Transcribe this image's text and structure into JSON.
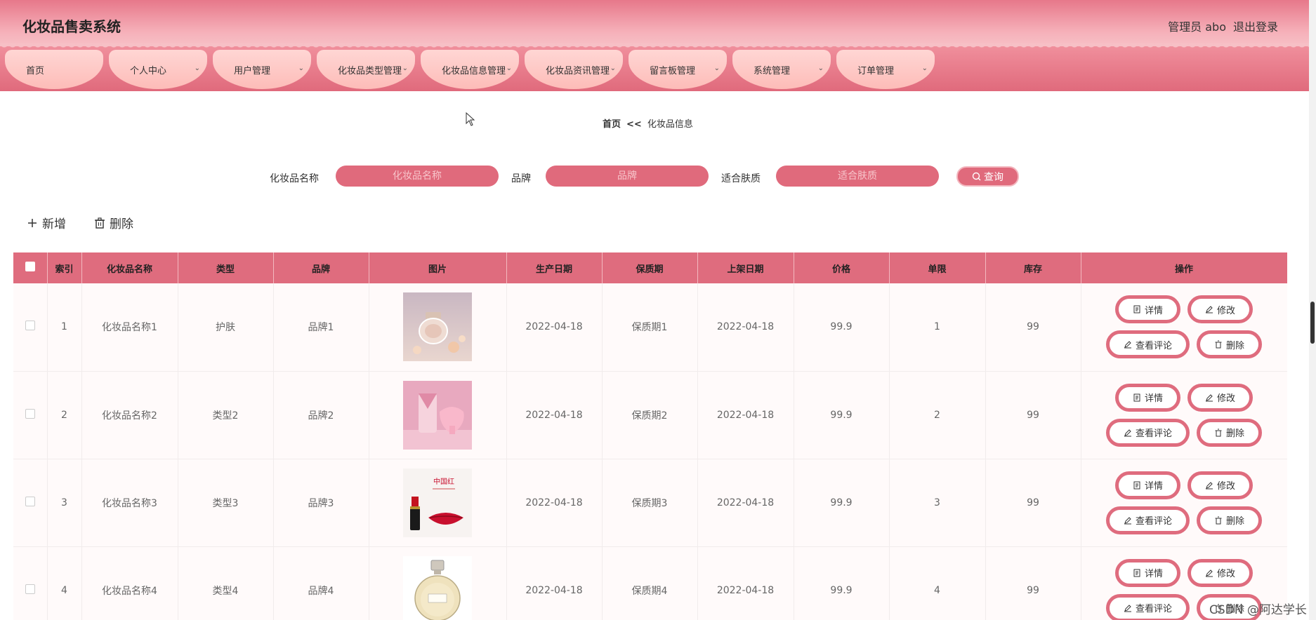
{
  "header": {
    "title": "化妆品售卖系统",
    "admin": "管理员 abo",
    "logout": "退出登录"
  },
  "nav": [
    {
      "label": "首页",
      "has_menu": false
    },
    {
      "label": "个人中心",
      "has_menu": true
    },
    {
      "label": "用户管理",
      "has_menu": true
    },
    {
      "label": "化妆品类型管理",
      "has_menu": true
    },
    {
      "label": "化妆品信息管理",
      "has_menu": true
    },
    {
      "label": "化妆品资讯管理",
      "has_menu": true
    },
    {
      "label": "留言板管理",
      "has_menu": true
    },
    {
      "label": "系统管理",
      "has_menu": true
    },
    {
      "label": "订单管理",
      "has_menu": true
    }
  ],
  "breadcrumb": {
    "home": "首页",
    "sep": "<<",
    "current": "化妆品信息"
  },
  "search": {
    "name_label": "化妆品名称",
    "name_placeholder": "化妆品名称",
    "brand_label": "品牌",
    "brand_placeholder": "品牌",
    "skin_label": "适合肤质",
    "skin_placeholder": "适合肤质",
    "query_label": "查询"
  },
  "toolbar": {
    "add_label": "新增",
    "delete_label": "删除"
  },
  "table": {
    "columns": [
      "索引",
      "化妆品名称",
      "类型",
      "品牌",
      "图片",
      "生产日期",
      "保质期",
      "上架日期",
      "价格",
      "单限",
      "库存",
      "操作"
    ],
    "rows": [
      {
        "index": "1",
        "name": "化妆品名称1",
        "type": "护肤",
        "brand": "品牌1",
        "image": "perfume-bottle-pink",
        "prod_date": "2022-04-18",
        "shelf_life": "保质期1",
        "listed_date": "2022-04-18",
        "price": "99.9",
        "limit": "1",
        "stock": "99"
      },
      {
        "index": "2",
        "name": "化妆品名称2",
        "type": "类型2",
        "brand": "品牌2",
        "image": "pink-cosmetic-device",
        "prod_date": "2022-04-18",
        "shelf_life": "保质期2",
        "listed_date": "2022-04-18",
        "price": "99.9",
        "limit": "2",
        "stock": "99"
      },
      {
        "index": "3",
        "name": "化妆品名称3",
        "type": "类型3",
        "brand": "品牌3",
        "image": "red-lipstick",
        "image_caption": "中国红",
        "prod_date": "2022-04-18",
        "shelf_life": "保质期3",
        "listed_date": "2022-04-18",
        "price": "99.9",
        "limit": "3",
        "stock": "99"
      },
      {
        "index": "4",
        "name": "化妆品名称4",
        "type": "类型4",
        "brand": "品牌4",
        "image": "chanel-perfume",
        "prod_date": "2022-04-18",
        "shelf_life": "保质期4",
        "listed_date": "2022-04-18",
        "price": "99.9",
        "limit": "4",
        "stock": "99"
      }
    ],
    "actions": {
      "detail": "详情",
      "edit": "修改",
      "comments": "查看评论",
      "delete": "删除"
    }
  },
  "watermark": "CSDN @阿达学长",
  "colors": {
    "accent": "#df6c7e",
    "nav_tab": "#fdbcb8",
    "header_top": "#e7788a"
  }
}
